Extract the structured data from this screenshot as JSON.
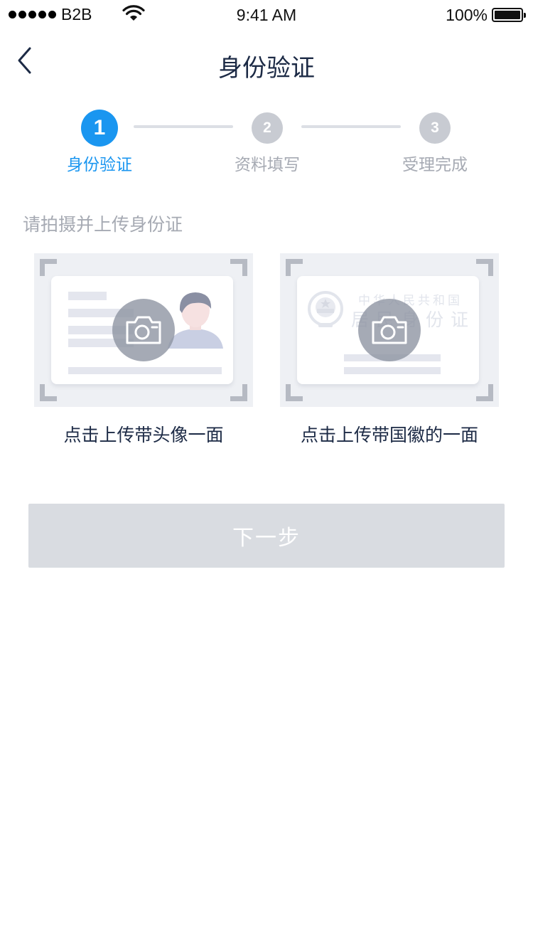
{
  "status_bar": {
    "carrier": "B2B",
    "time": "9:41 AM",
    "battery_percent": "100%",
    "battery_level": 1.0,
    "signal_dots": 5
  },
  "nav": {
    "title": "身份验证",
    "back_icon": "chevron-left-icon"
  },
  "steps": [
    {
      "number": "1",
      "label": "身份验证",
      "state": "active"
    },
    {
      "number": "2",
      "label": "资料填写",
      "state": "inactive"
    },
    {
      "number": "3",
      "label": "受理完成",
      "state": "inactive"
    }
  ],
  "instruction": "请拍摄并上传身份证",
  "upload_front": {
    "caption": "点击上传带头像一面",
    "icon": "camera-icon"
  },
  "upload_back": {
    "caption": "点击上传带国徽的一面",
    "icon": "camera-icon",
    "card_line1": "中华人民共和国",
    "card_line2": "居民身份证"
  },
  "next_button": {
    "label": "下一步",
    "enabled": false
  },
  "colors": {
    "accent": "#1a96f0",
    "step_inactive": "#c8cbd2",
    "text_primary": "#1c2a45",
    "text_secondary": "#a6aab3",
    "button_disabled": "#d9dce1"
  }
}
